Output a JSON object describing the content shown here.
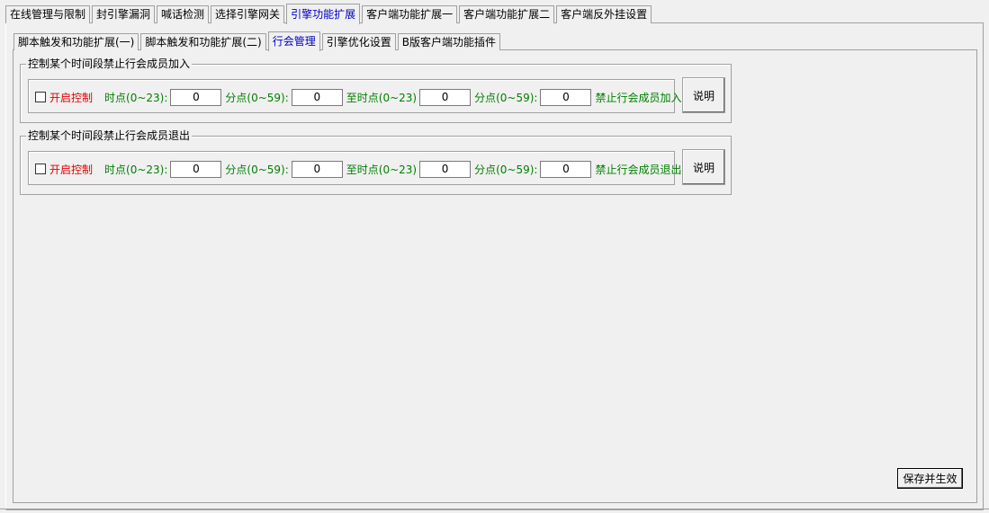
{
  "top_tabs": [
    {
      "label": "在线管理与限制"
    },
    {
      "label": "封引擎漏洞"
    },
    {
      "label": "喊话检测"
    },
    {
      "label": "选择引擎网关"
    },
    {
      "label": "引擎功能扩展",
      "active": true
    },
    {
      "label": "客户端功能扩展一"
    },
    {
      "label": "客户端功能扩展二"
    },
    {
      "label": "客户端反外挂设置"
    }
  ],
  "sub_tabs": [
    {
      "label": "脚本触发和功能扩展(一)"
    },
    {
      "label": "脚本触发和功能扩展(二)"
    },
    {
      "label": "行会管理",
      "active": true
    },
    {
      "label": "引擎优化设置"
    },
    {
      "label": "B版客户端功能插件"
    }
  ],
  "groups": [
    {
      "title": "控制某个时间段禁止行会成员加入",
      "enable_label": "开启控制",
      "enabled": false,
      "hour_label": "时点(0~23):",
      "hour_value": "0",
      "minute_label": "分点(0~59):",
      "minute_value": "0",
      "to_hour_label": "至时点(0~23)",
      "to_hour_value": "0",
      "to_minute_label": "分点(0~59):",
      "to_minute_value": "0",
      "action_label": "禁止行会成员加入",
      "explain_label": "说明"
    },
    {
      "title": "控制某个时间段禁止行会成员退出",
      "enable_label": "开启控制",
      "enabled": false,
      "hour_label": "时点(0~23):",
      "hour_value": "0",
      "minute_label": "分点(0~59):",
      "minute_value": "0",
      "to_hour_label": "至时点(0~23)",
      "to_hour_value": "0",
      "to_minute_label": "分点(0~59):",
      "to_minute_value": "0",
      "action_label": "禁止行会成员退出",
      "explain_label": "说明"
    }
  ],
  "save_label": "保存并生效",
  "colors": {
    "active_tab": "#0000c8",
    "enable_text": "#e00000",
    "field_labels": "#008000"
  }
}
